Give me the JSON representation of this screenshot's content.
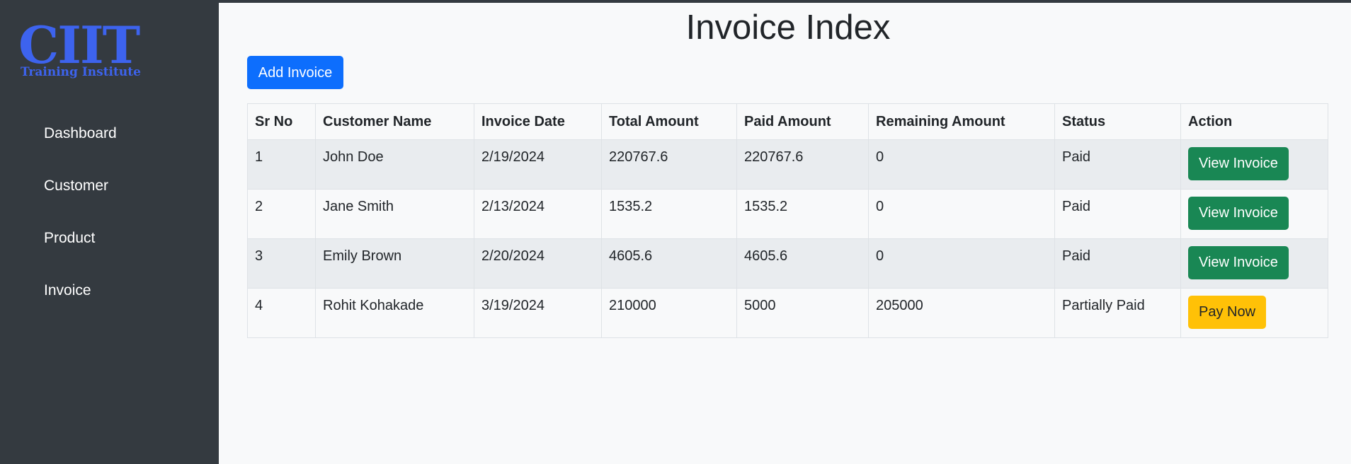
{
  "sidebar": {
    "logo": {
      "title": "CIIT",
      "subtitle": "Training Institute"
    },
    "items": [
      {
        "label": "Dashboard"
      },
      {
        "label": "Customer"
      },
      {
        "label": "Product"
      },
      {
        "label": "Invoice"
      }
    ]
  },
  "main": {
    "title": "Invoice Index",
    "add_button": "Add Invoice",
    "table": {
      "headers": [
        "Sr No",
        "Customer Name",
        "Invoice Date",
        "Total Amount",
        "Paid Amount",
        "Remaining Amount",
        "Status",
        "Action"
      ],
      "rows": [
        {
          "sr": "1",
          "customer": "John Doe",
          "date": "2/19/2024",
          "total": "220767.6",
          "paid": "220767.6",
          "remaining": "0",
          "status": "Paid",
          "action": "View Invoice"
        },
        {
          "sr": "2",
          "customer": "Jane Smith",
          "date": "2/13/2024",
          "total": "1535.2",
          "paid": "1535.2",
          "remaining": "0",
          "status": "Paid",
          "action": "View Invoice"
        },
        {
          "sr": "3",
          "customer": "Emily Brown",
          "date": "2/20/2024",
          "total": "4605.6",
          "paid": "4605.6",
          "remaining": "0",
          "status": "Paid",
          "action": "View Invoice"
        },
        {
          "sr": "4",
          "customer": "Rohit Kohakade",
          "date": "3/19/2024",
          "total": "210000",
          "paid": "5000",
          "remaining": "205000",
          "status": "Partially Paid",
          "action": "Pay Now"
        }
      ]
    }
  },
  "colors": {
    "sidebar_bg": "#343a40",
    "primary": "#0d6efd",
    "success": "#198754",
    "warning": "#ffc107",
    "logo": "#3d63ee"
  }
}
